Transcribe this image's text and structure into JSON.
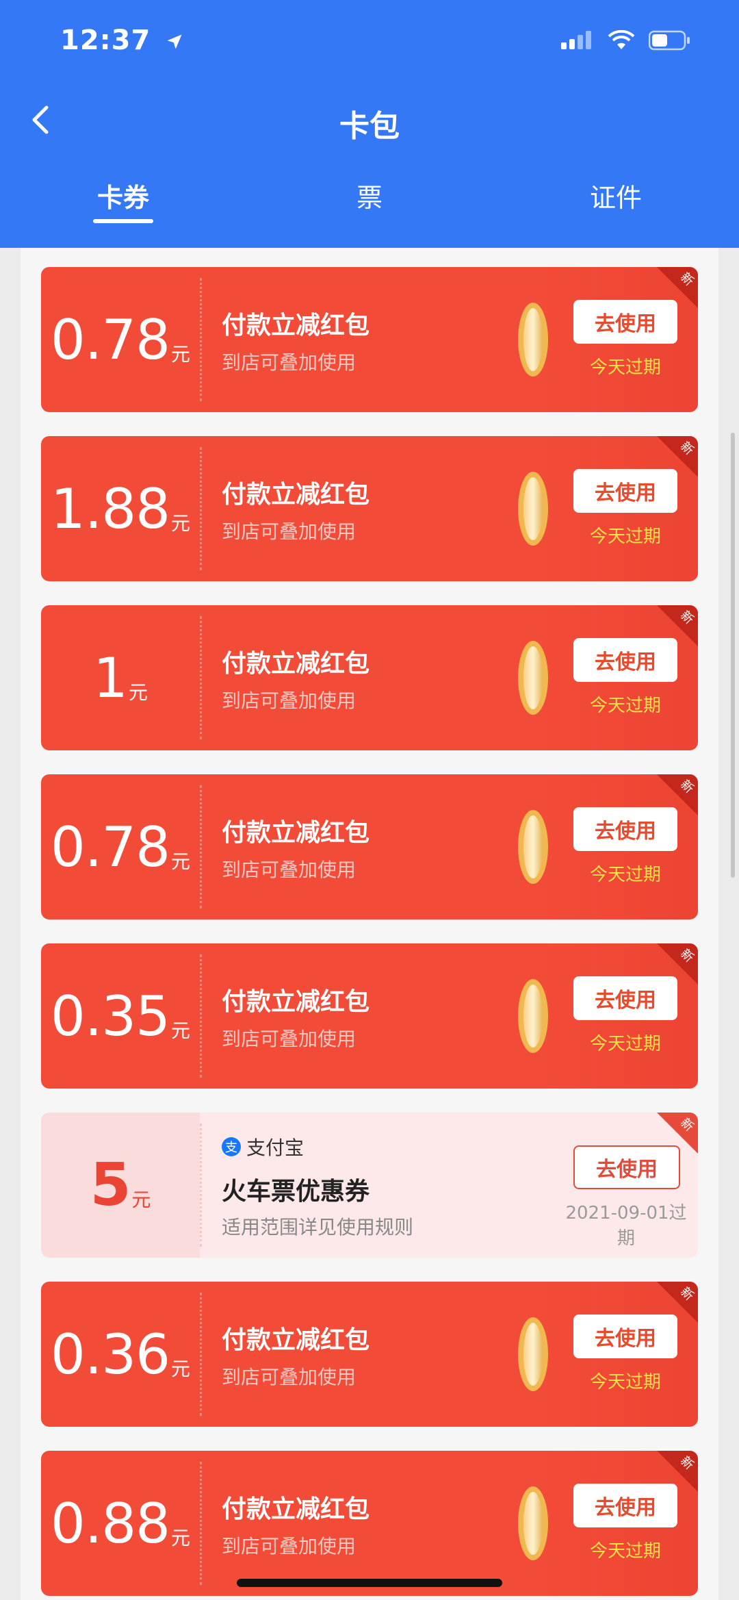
{
  "status_bar": {
    "time": "12:37"
  },
  "header": {
    "title": "卡包"
  },
  "tabs": [
    {
      "label": "卡券",
      "active": true
    },
    {
      "label": "票",
      "active": false
    },
    {
      "label": "证件",
      "active": false
    }
  ],
  "coupons": [
    {
      "amount": "0.78",
      "unit": "元",
      "title": "付款立减红包",
      "subtitle": "到店可叠加使用",
      "button": "去使用",
      "expire": "今天过期",
      "badge": "新"
    },
    {
      "amount": "1.88",
      "unit": "元",
      "title": "付款立减红包",
      "subtitle": "到店可叠加使用",
      "button": "去使用",
      "expire": "今天过期",
      "badge": "新"
    },
    {
      "amount": "1",
      "unit": "元",
      "title": "付款立减红包",
      "subtitle": "到店可叠加使用",
      "button": "去使用",
      "expire": "今天过期",
      "badge": "新"
    },
    {
      "amount": "0.78",
      "unit": "元",
      "title": "付款立减红包",
      "subtitle": "到店可叠加使用",
      "button": "去使用",
      "expire": "今天过期",
      "badge": "新"
    },
    {
      "amount": "0.35",
      "unit": "元",
      "title": "付款立减红包",
      "subtitle": "到店可叠加使用",
      "button": "去使用",
      "expire": "今天过期",
      "badge": "新"
    },
    {
      "amount": "5",
      "unit": "元",
      "brand": "支付宝",
      "brand_icon": "支",
      "title": "火车票优惠券",
      "subtitle": "适用范围详见使用规则",
      "button": "去使用",
      "expire": "2021-09-01过期",
      "badge": "新"
    },
    {
      "amount": "0.36",
      "unit": "元",
      "title": "付款立减红包",
      "subtitle": "到店可叠加使用",
      "button": "去使用",
      "expire": "今天过期",
      "badge": "新"
    },
    {
      "amount": "0.88",
      "unit": "元",
      "title": "付款立减红包",
      "subtitle": "到店可叠加使用",
      "button": "去使用",
      "expire": "今天过期",
      "badge": "新"
    }
  ],
  "colors": {
    "header": "#3478f6",
    "coupon_red": "#f24b37",
    "coupon_light": "#fde9e9",
    "expire_yellow": "#ffe14a"
  }
}
